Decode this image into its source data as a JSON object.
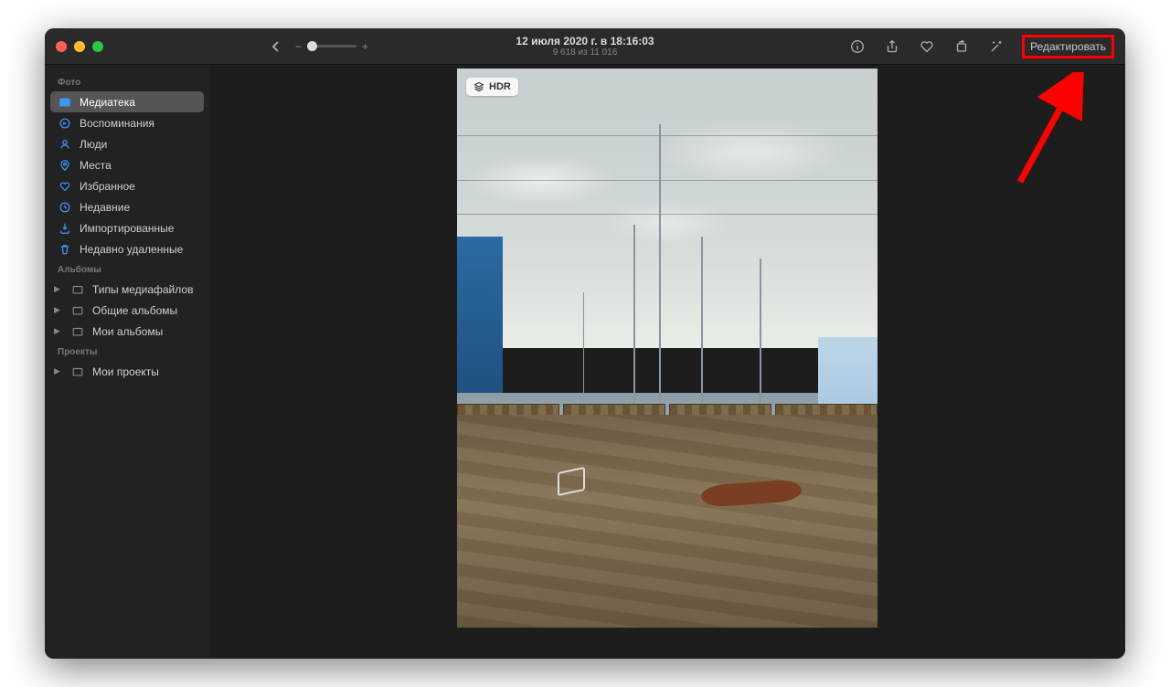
{
  "toolbar": {
    "date_line": "12 июля 2020 г. в 18:16:03",
    "count_line": "9 618 из 11 016",
    "zoom_minus": "−",
    "zoom_plus": "+",
    "edit_label": "Редактировать"
  },
  "badge": {
    "hdr_label": "HDR"
  },
  "sidebar": {
    "section_photo": "Фото",
    "items": [
      {
        "label": "Медиатека",
        "icon": "photos-icon",
        "selected": true
      },
      {
        "label": "Воспоминания",
        "icon": "memories-icon"
      },
      {
        "label": "Люди",
        "icon": "people-icon"
      },
      {
        "label": "Места",
        "icon": "places-icon"
      },
      {
        "label": "Избранное",
        "icon": "heart-icon"
      },
      {
        "label": "Недавние",
        "icon": "clock-icon"
      },
      {
        "label": "Импортированные",
        "icon": "import-icon"
      },
      {
        "label": "Недавно удаленные",
        "icon": "trash-icon"
      }
    ],
    "section_albums": "Альбомы",
    "albums": [
      {
        "label": "Типы медиафайлов"
      },
      {
        "label": "Общие альбомы"
      },
      {
        "label": "Мои альбомы"
      }
    ],
    "section_projects": "Проекты",
    "projects": [
      {
        "label": "Мои проекты"
      }
    ]
  },
  "colors": {
    "accent": "#3b99fc",
    "annotation": "#ff0000"
  }
}
